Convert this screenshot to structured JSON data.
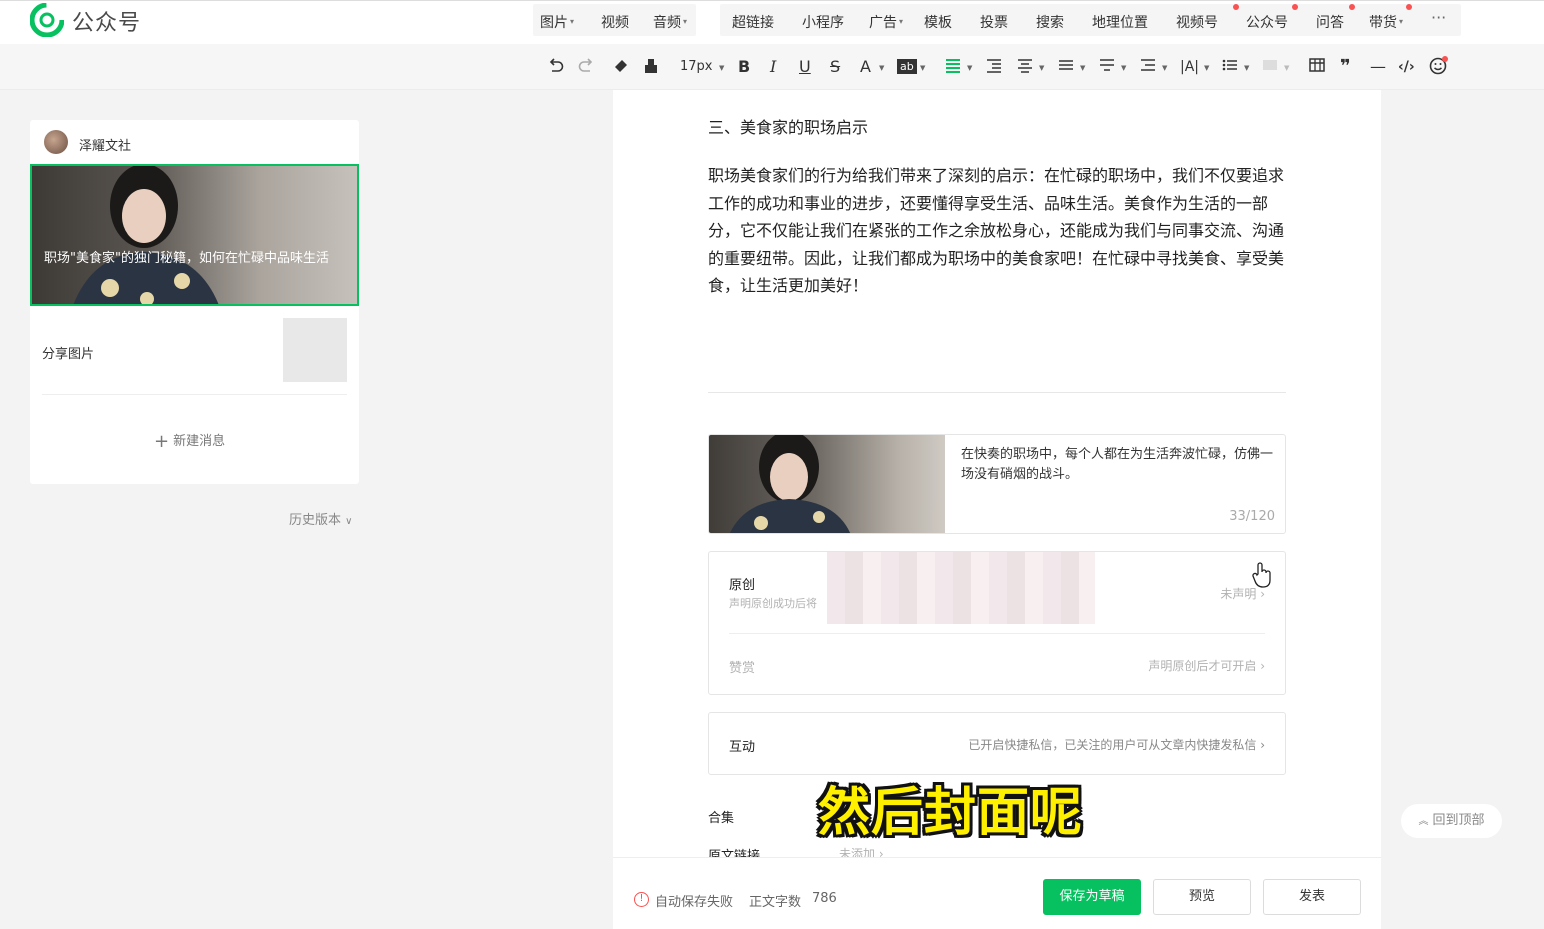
{
  "app": {
    "name": "公众号"
  },
  "insert_menu": {
    "media": [
      {
        "label": "图片",
        "caret": true
      },
      {
        "label": "视频",
        "caret": false
      },
      {
        "label": "音频",
        "caret": true
      }
    ],
    "tools": [
      {
        "label": "超链接"
      },
      {
        "label": "小程序"
      },
      {
        "label": "广告",
        "caret": true
      },
      {
        "label": "模板"
      },
      {
        "label": "投票"
      },
      {
        "label": "搜索"
      },
      {
        "label": "地理位置"
      },
      {
        "label": "视频号",
        "dot": true
      },
      {
        "label": "公众号",
        "dot": true
      },
      {
        "label": "问答",
        "dot": true
      },
      {
        "label": "带货",
        "caret": true,
        "dot": true
      }
    ],
    "more": "···"
  },
  "toolbar": {
    "font_size": "17px",
    "bold": "B",
    "italic": "I",
    "underline": "U",
    "strike": "S",
    "font_color": "A",
    "bg_color": "ab",
    "letter_spacing": "|A|",
    "quote": "❞",
    "code": "‹/›",
    "hr": "—"
  },
  "colors": {
    "brand": "#07c160",
    "alert": "#fa5151",
    "subtitle": "#fff000"
  },
  "left_panel": {
    "account_name": "泽耀文社",
    "cover_title": "职场\"美食家\"的独门秘籍，如何在忙碌中品味生活",
    "share_label": "分享图片",
    "new_message": "新建消息",
    "history": "历史版本"
  },
  "article": {
    "section_heading": "三、美食家的职场启示",
    "paragraph": "职场美食家们的行为给我们带来了深刻的启示：在忙碌的职场中，我们不仅要追求工作的成功和事业的进步，还要懂得享受生活、品味生活。美食作为生活的一部分，它不仅能让我们在紧张的工作之余放松身心，还能成为我们与同事交流、沟通的重要纽带。因此，让我们都成为职场中的美食家吧！在忙碌中寻找美食、享受美食，让生活更加美好！"
  },
  "digest": {
    "text": "在快奏的职场中，每个人都在为生活奔波忙碌，仿佛一场没有硝烟的战斗。",
    "count": "33/120"
  },
  "original": {
    "title": "原创",
    "desc": "声明原创成功后将",
    "status": "未声明 ›"
  },
  "reward": {
    "title": "赞赏",
    "status": "声明原创后才可开启 ›"
  },
  "interaction": {
    "title": "互动",
    "status": "已开启快捷私信，已关注的用户可从文章内快捷发私信 ›"
  },
  "collection": {
    "title": "合集"
  },
  "source_link": {
    "title": "原文链接",
    "status": "未添加 ›"
  },
  "footer": {
    "autosave": "自动保存失败",
    "word_count_label": "正文字数",
    "word_count": "786",
    "save_draft": "保存为草稿",
    "preview": "预览",
    "publish": "发表"
  },
  "subtitle_overlay": "然后封面呢",
  "back_to_top": "回到顶部"
}
